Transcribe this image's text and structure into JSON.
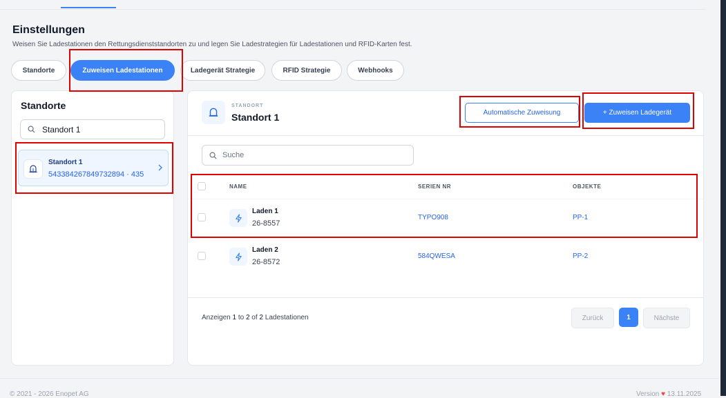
{
  "page": {
    "title": "Einstellungen",
    "subtitle": "Weisen Sie Ladestationen den Rettungsdienststandorten zu und legen Sie Ladestrategien für Ladestationen und RFID-Karten fest."
  },
  "tabs": [
    {
      "label": "Standorte"
    },
    {
      "label": "Zuweisen Ladestationen",
      "active": true
    },
    {
      "label": "Ladegerät Strategie"
    },
    {
      "label": "RFID Strategie"
    },
    {
      "label": "Webhooks"
    }
  ],
  "sidebar": {
    "title": "Standorte",
    "search_value": "Standort 1",
    "items": [
      {
        "name": "Standort 1",
        "meta": "543384267849732894 · 435"
      }
    ]
  },
  "detail": {
    "label": "STANDORT",
    "title": "Standort 1",
    "auto_assign_label": "Automatische Zuweisung",
    "assign_label": "+  Zuweisen Ladegerät",
    "search_placeholder": "Suche",
    "columns": {
      "name": "NAME",
      "serial": "SERIEN NR",
      "objects": "OBJEKTE"
    },
    "rows": [
      {
        "name": "Laden 1",
        "id": "26-8557",
        "serial": "TYPO908",
        "objects": "PP-1"
      },
      {
        "name": "Laden 2",
        "id": "26-8572",
        "serial": "584QWESA",
        "objects": "PP-2"
      }
    ]
  },
  "pagination": {
    "prefix": "Anzeigen",
    "from": "1",
    "to_word": "to",
    "to": "2",
    "of_word": "of",
    "total": "2",
    "suffix": "Ladestationen",
    "prev_label": "Zurück",
    "current_page": "1",
    "next_label": "Nächste"
  },
  "footer": {
    "copyright": "© 2021 - 2026 Enopet AG",
    "version_prefix": "Version",
    "version_heart": "♥",
    "version_date": "13.11.2025"
  },
  "colors": {
    "accent": "#3b82f6",
    "highlight": "#e00000"
  },
  "icons": {
    "search": "search-icon",
    "location": "location-bell-icon",
    "chevron": "chevron-right-icon",
    "charger": "lightning-bolt-icon"
  }
}
